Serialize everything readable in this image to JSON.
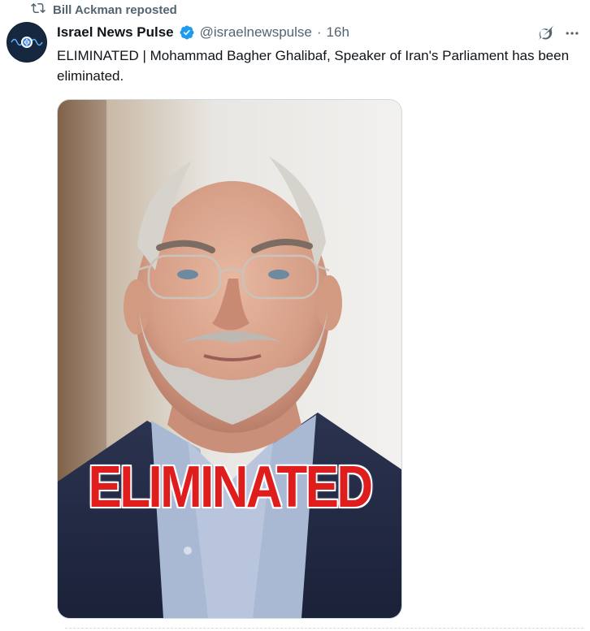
{
  "repost": {
    "label": "Bill Ackman reposted",
    "icon": "repost-icon"
  },
  "tweet": {
    "display_name": "Israel News Pulse",
    "handle": "@israelnewspulse",
    "separator": "·",
    "time": "16h",
    "verified_color": "#1d9bf0",
    "text": "ELIMINATED | Mohammad Bagher Ghalibaf, Speaker of Iran's Parliament has been eliminated.",
    "media_overlay": "ELIMINATED",
    "icons": [
      "grok-icon",
      "more-icon",
      "verified-badge-icon"
    ]
  },
  "colors": {
    "text_primary": "#0f1419",
    "text_secondary": "#536471",
    "overlay_red": "#e01d1d"
  }
}
